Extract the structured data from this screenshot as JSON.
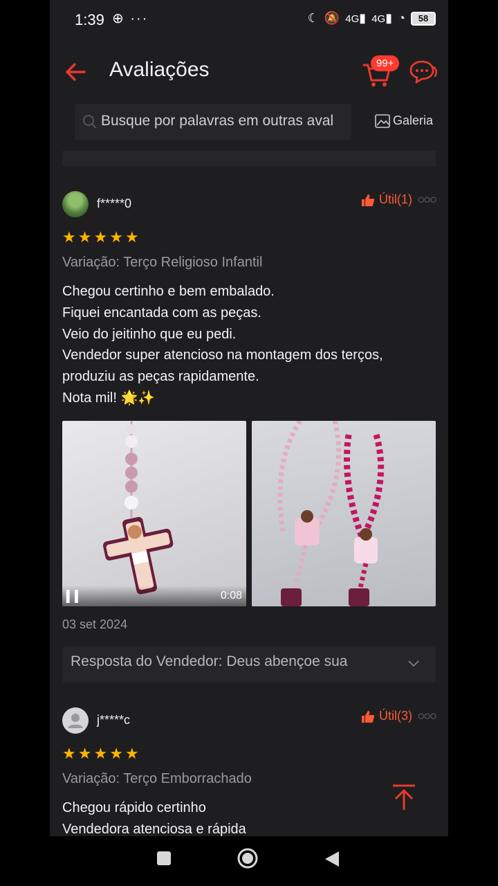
{
  "status_bar": {
    "time": "1:39",
    "left_icons": "⊕ ···",
    "network_1": "4G",
    "network_2": "4G",
    "battery": "58"
  },
  "header": {
    "title": "Avaliações",
    "cart_badge": "99+"
  },
  "search": {
    "placeholder": "Busque por palavras em outras aval",
    "gallery_label": "Galeria"
  },
  "reviews": [
    {
      "username": "f*****0",
      "util_label": "Útil(1)",
      "rating": 5,
      "variation": "Variação: Terço Religioso Infantil",
      "text": "Chegou certinho e bem embalado.\nFiquei encantada com as peças.\nVeio do jeitinho que eu pedi.\nVendedor super atencioso na montagem dos terços, produziu as peças rapidamente.\nNota mil! 🌟✨",
      "video_duration": "0:08",
      "date": "03 set 2024",
      "seller_reply": "Resposta do Vendedor: Deus abençoe sua"
    },
    {
      "username": "j*****c",
      "util_label": "Útil(3)",
      "rating": 5,
      "variation": "Variação: Terço Emborrachado",
      "text": "Chegou rápido certinho\nVendedora atenciosa e rápida"
    }
  ],
  "colors": {
    "accent": "#ff3b30",
    "star": "#ffb400",
    "background": "#1e1e20"
  }
}
